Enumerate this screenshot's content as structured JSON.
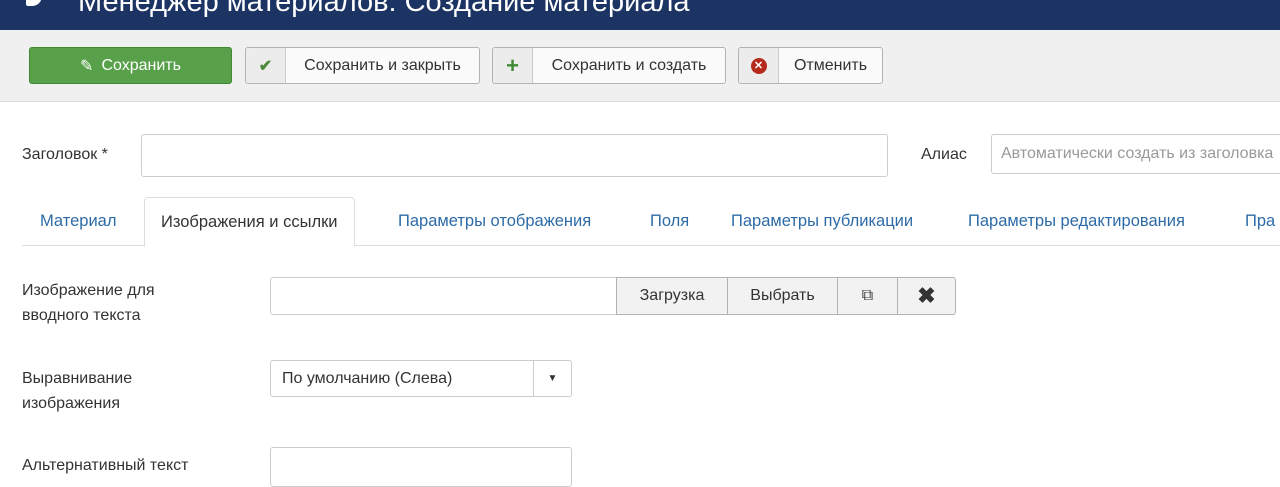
{
  "header": {
    "title": "Менеджер материалов: Создание материала"
  },
  "toolbar": {
    "save": "Сохранить",
    "save_close": "Сохранить и закрыть",
    "save_new": "Сохранить и создать",
    "cancel": "Отменить"
  },
  "form": {
    "title_label": "Заголовок *",
    "title_value": "",
    "alias_label": "Алиас",
    "alias_placeholder": "Автоматически создать из заголовка"
  },
  "tabs": [
    "Материал",
    "Изображения и ссылки",
    "Параметры отображения",
    "Поля",
    "Параметры публикации",
    "Параметры редактирования",
    "Пра"
  ],
  "fields": {
    "intro_image_label": "Изображение для вводного текста",
    "upload": "Загрузка",
    "select": "Выбрать",
    "align_label": "Выравнивание изображения",
    "align_value": "По умолчанию (Слева)",
    "alt_label": "Альтернативный текст"
  }
}
